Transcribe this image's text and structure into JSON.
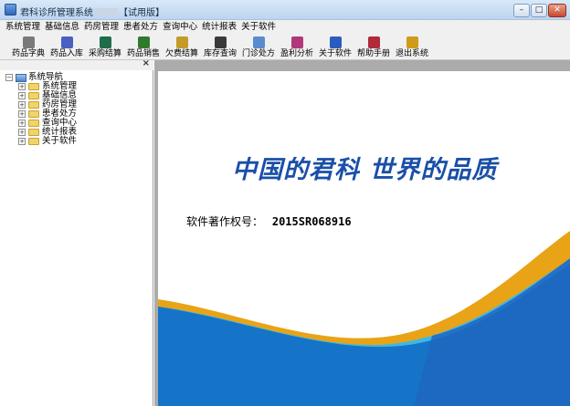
{
  "window": {
    "title": "君科诊所管理系统",
    "title_suffix": "【试用版】",
    "controls": {
      "minimize": "–",
      "maximize": "□",
      "close": "✕"
    }
  },
  "menubar": {
    "items": [
      "系统管理",
      "基础信息",
      "药房管理",
      "患者处方",
      "查询中心",
      "统计报表",
      "关于软件"
    ]
  },
  "toolbar": {
    "items": [
      {
        "label": "药品字典",
        "icon": "pill-icon",
        "color": "#7a7a7a"
      },
      {
        "label": "药品入库",
        "icon": "stock-in-icon",
        "color": "#4a5fc0"
      },
      {
        "label": "采购结算",
        "icon": "purchase-icon",
        "color": "#1f6b4a"
      },
      {
        "label": "药品销售",
        "icon": "sale-icon",
        "color": "#2f7a2f"
      },
      {
        "label": "欠费结算",
        "icon": "debt-icon",
        "color": "#c49a2a"
      },
      {
        "label": "库存查询",
        "icon": "bank-icon",
        "color": "#3a3a3a"
      },
      {
        "label": "门诊处方",
        "icon": "prescription-icon",
        "color": "#5a8ad0"
      },
      {
        "label": "盈利分析",
        "icon": "chart-icon",
        "color": "#b0387a"
      },
      {
        "label": "关于软件",
        "icon": "help-circle-icon",
        "color": "#2a5cc0"
      },
      {
        "label": "帮助手册",
        "icon": "book-icon",
        "color": "#b02a3a"
      },
      {
        "label": "退出系统",
        "icon": "exit-icon",
        "color": "#d09a1a"
      }
    ]
  },
  "navigation": {
    "close_glyph": "×",
    "root": "系统导航",
    "root_expander": "−",
    "child_expander": "+",
    "items": [
      "系统管理",
      "基础信息",
      "药房管理",
      "患者处方",
      "查询中心",
      "统计报表",
      "关于软件"
    ]
  },
  "main": {
    "slogan": "中国的君科 世界的品质",
    "copyright_label": "软件著作权号：",
    "copyright_value": "2015SR068916",
    "colors": {
      "slogan": "#1a4fa8",
      "wave_gold": "#e8a317",
      "wave_blue": "#1574c8",
      "wave_cyan": "#3fb7e6"
    }
  }
}
